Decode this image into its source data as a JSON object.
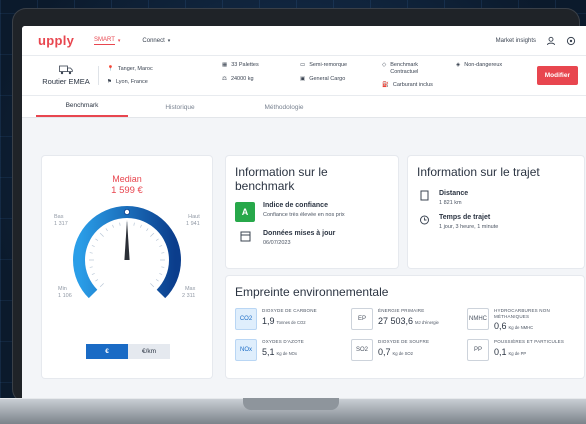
{
  "colors": {
    "accent": "#e8464f",
    "primary_blue": "#1a6bc5",
    "success": "#27a84a"
  },
  "nav": {
    "logo": "upply",
    "items": [
      {
        "label": "SMART",
        "active": true
      },
      {
        "label": "Connect",
        "active": false
      }
    ],
    "market_insights": "Market insights",
    "icons": [
      "user-icon",
      "settings-icon"
    ]
  },
  "route": {
    "title": "Routier EMEA",
    "origin": "Tanger, Maroc",
    "destination": "Lyon, France",
    "col1": [
      "33 Palettes",
      "24000 kg"
    ],
    "col2": [
      "Semi-remorque",
      "General Cargo"
    ],
    "col3_line1a": "Benchmark",
    "col3_line1b": "Contractuel",
    "col3_line2": "Carburant inclus",
    "col4": "Non-dangereux",
    "modify_label": "Modifier"
  },
  "tabs": [
    {
      "label": "Benchmark",
      "active": true
    },
    {
      "label": "Historique",
      "active": false
    },
    {
      "label": "Méthodologie",
      "active": false
    }
  ],
  "gauge": {
    "median_label": "Median",
    "median_value": "1 599 €",
    "bas_label": "Bas",
    "bas_value": "1 317",
    "haut_label": "Haut",
    "haut_value": "1 941",
    "min_label": "Min",
    "min_value": "1 106",
    "max_label": "Max",
    "max_value": "2 311",
    "needle_fraction": 0.5,
    "toggle_on": "€",
    "toggle_off": "€/km"
  },
  "benchmark_info": {
    "title": "Information sur le benchmark",
    "confidence_badge": "A",
    "confidence_title": "Indice de confiance",
    "confidence_sub": "Confiance très élevée en nos prix",
    "update_title": "Données mises à jour",
    "update_date": "06/07/2023"
  },
  "trip_info": {
    "title": "Information sur le trajet",
    "distance_title": "Distance",
    "distance_value": "1 821 km",
    "time_title": "Temps de trajet",
    "time_value": "1 jour, 3 heure, 1 minute"
  },
  "environment": {
    "title": "Empreinte environnementale",
    "items": [
      {
        "code": "CO2",
        "name": "DIOXYDE DE CARBONE",
        "value": "1,9",
        "unit": "Tonnes de CO2",
        "highlight": true
      },
      {
        "code": "EP",
        "name": "ÉNERGIE PRIMAIRE",
        "value": "27 503,6",
        "unit": "MJ d'énergie",
        "highlight": false
      },
      {
        "code": "NMHC",
        "name": "HYDROCARBURES NON MÉTHANIQUES",
        "value": "0,6",
        "unit": "Kg de NMHC",
        "highlight": false
      },
      {
        "code": "NOx",
        "name": "OXYDES D'AZOTE",
        "value": "5,1",
        "unit": "Kg de NOx",
        "highlight": true
      },
      {
        "code": "SO2",
        "name": "DIOXYDE DE SOUFRE",
        "value": "0,7",
        "unit": "Kg de SO2",
        "highlight": false
      },
      {
        "code": "PP",
        "name": "POUSSIÈRES ET PARTICULES",
        "value": "0,1",
        "unit": "Kg de PP",
        "highlight": false
      }
    ]
  }
}
